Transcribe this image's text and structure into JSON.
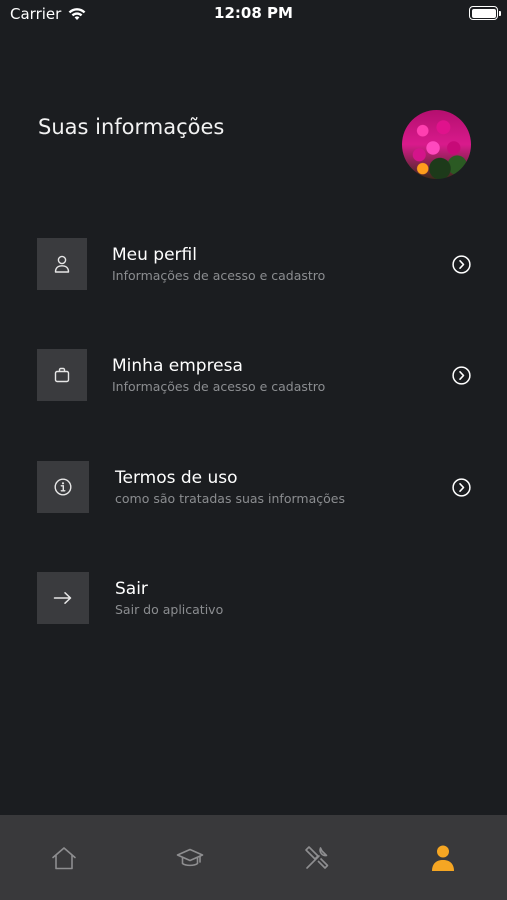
{
  "status_bar": {
    "carrier": "Carrier",
    "time": "12:08 PM",
    "wifi_icon": "wifi-icon",
    "battery_icon": "battery-icon"
  },
  "header": {
    "title": "Suas informações",
    "avatar": "avatar-flowers"
  },
  "menu": {
    "items": [
      {
        "title": "Meu perfil",
        "subtitle": "Informações de acesso e cadastro",
        "icon": "user-icon",
        "chevron": true
      },
      {
        "title": "Minha empresa",
        "subtitle": "Informações de acesso e cadastro",
        "icon": "briefcase-icon",
        "chevron": true
      },
      {
        "title": "Termos de uso",
        "subtitle": "como são tratadas suas informações",
        "icon": "info-icon",
        "chevron": true
      },
      {
        "title": "Sair",
        "subtitle": "Sair do aplicativo",
        "icon": "arrow-right-icon",
        "chevron": false
      }
    ]
  },
  "tab_bar": {
    "tabs": [
      {
        "icon": "home-icon",
        "active": false
      },
      {
        "icon": "graduation-cap-icon",
        "active": false
      },
      {
        "icon": "tools-icon",
        "active": false
      },
      {
        "icon": "person-icon",
        "active": true
      }
    ],
    "active_color": "#f5a623",
    "inactive_color": "#8e8e90"
  },
  "colors": {
    "background": "#1b1d20",
    "icon_box": "#3a3b3e",
    "subtitle": "#8b8d90",
    "tab_bar": "#39393b"
  }
}
